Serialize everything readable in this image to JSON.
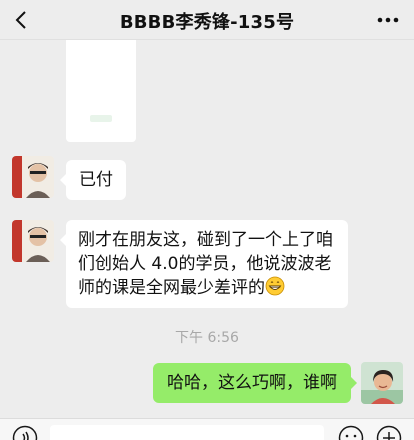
{
  "header": {
    "title": "BBBB李秀锋-135号",
    "back_icon": "chevron-left-icon",
    "more_icon": "more-dots-icon"
  },
  "messages": [
    {
      "side": "left",
      "type": "card",
      "label": ""
    },
    {
      "side": "left",
      "type": "text",
      "text": "已付"
    },
    {
      "side": "left",
      "type": "text",
      "text_lines": [
        "刚才在朋友这，碰到了一个上了咱",
        "们创始人 4.0的学员，他说波波老",
        "师的课是全网最少差评的"
      ],
      "emoji": "grin-emoji"
    },
    {
      "side": "right",
      "type": "text",
      "text": "哈哈，这么巧啊，谁啊"
    }
  ],
  "timestamp": "下午 6:56",
  "input_bar": {
    "voice_icon": "voice-icon",
    "emoji_icon": "emoji-icon",
    "plus_icon": "plus-icon",
    "placeholder": ""
  },
  "colors": {
    "background": "#ededed",
    "bubble_self": "#95ec69",
    "bubble_other": "#ffffff",
    "timestamp": "#a8a8a8"
  }
}
